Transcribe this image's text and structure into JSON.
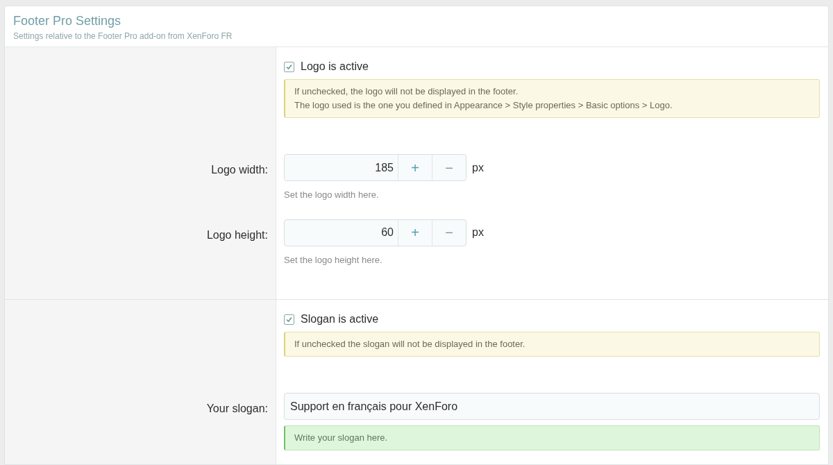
{
  "header": {
    "title": "Footer Pro Settings",
    "subtitle": "Settings relative to the Footer Pro add-on from XenForo FR"
  },
  "groups": [
    {
      "rows": [
        {
          "kind": "checkbox",
          "label": "Logo is active",
          "checked": true,
          "note": {
            "kind": "warning",
            "lines": [
              "If unchecked, the logo will not be displayed in the footer.",
              "The logo used is the one you defined in Appearance > Style properties > Basic options > Logo."
            ]
          }
        },
        {
          "kind": "number",
          "label": "Logo width:",
          "value": "185",
          "plus": "+",
          "minus": "−",
          "unit": "px",
          "hint": "Set the logo width here."
        },
        {
          "kind": "number",
          "label": "Logo height:",
          "value": "60",
          "plus": "+",
          "minus": "−",
          "unit": "px",
          "hint": "Set the logo height here."
        }
      ]
    },
    {
      "rows": [
        {
          "kind": "checkbox",
          "label": "Slogan is active",
          "checked": true,
          "note": {
            "kind": "warning",
            "lines": [
              "If unchecked the slogan will not be displayed in the footer."
            ]
          }
        },
        {
          "kind": "text",
          "label": "Your slogan:",
          "value": "Support en français pour XenForo",
          "note": {
            "kind": "success",
            "lines": [
              "Write your slogan here."
            ]
          }
        }
      ]
    }
  ]
}
